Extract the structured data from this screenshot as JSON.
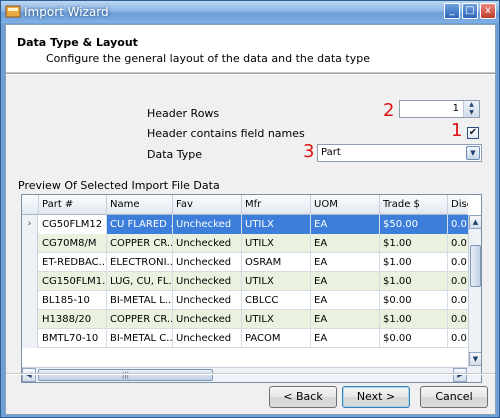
{
  "window": {
    "title": "Import Wizard",
    "controls": {
      "minimize": "_",
      "maximize": "□",
      "close": "x"
    }
  },
  "header": {
    "title": "Data Type & Layout",
    "subtitle": "Configure the general layout of the data and the data type"
  },
  "form": {
    "header_rows_label": "Header Rows",
    "header_rows_value": "1",
    "field_names_label": "Header contains field names",
    "field_names_checked": true,
    "data_type_label": "Data Type",
    "data_type_value": "Part"
  },
  "annotations": {
    "one": "1",
    "two": "2",
    "three": "3"
  },
  "preview": {
    "label": "Preview Of Selected Import File Data",
    "columns": [
      "Part #",
      "Name",
      "Fav",
      "Mfr",
      "UOM",
      "Trade $",
      "Disc %"
    ],
    "rows": [
      [
        "CG50FLM12",
        "CU FLARED ...",
        "Unchecked",
        "UTILX",
        "EA",
        "$50.00",
        "0.0"
      ],
      [
        "CG70M8/M",
        "COPPER CR...",
        "Unchecked",
        "UTILX",
        "EA",
        "$1.00",
        "0.0"
      ],
      [
        "ET-REDBAC...",
        "ELECTRONI...",
        "Unchecked",
        "OSRAM",
        "EA",
        "$1.00",
        "0.0"
      ],
      [
        "CG150FLM1...",
        "LUG, CU, FL...",
        "Unchecked",
        "UTILX",
        "EA",
        "$1.00",
        "0.0"
      ],
      [
        "BL185-10",
        "BI-METAL L...",
        "Unchecked",
        "CBLCC",
        "EA",
        "$0.00",
        "0.0"
      ],
      [
        "H1388/20",
        "COPPER CR...",
        "Unchecked",
        "UTILX",
        "EA",
        "$1.00",
        "0.0"
      ],
      [
        "BMTL70-10",
        "BI-METAL C...",
        "Unchecked",
        "PACOM",
        "EA",
        "$0.00",
        "0.0"
      ]
    ]
  },
  "buttons": {
    "back": "< Back",
    "next": "Next >",
    "cancel": "Cancel"
  },
  "colors": {
    "title_blue": "#6b9dd7",
    "selection": "#3d7edb",
    "alt_row": "#eaf2df",
    "annotation_red": "#dd1111"
  }
}
